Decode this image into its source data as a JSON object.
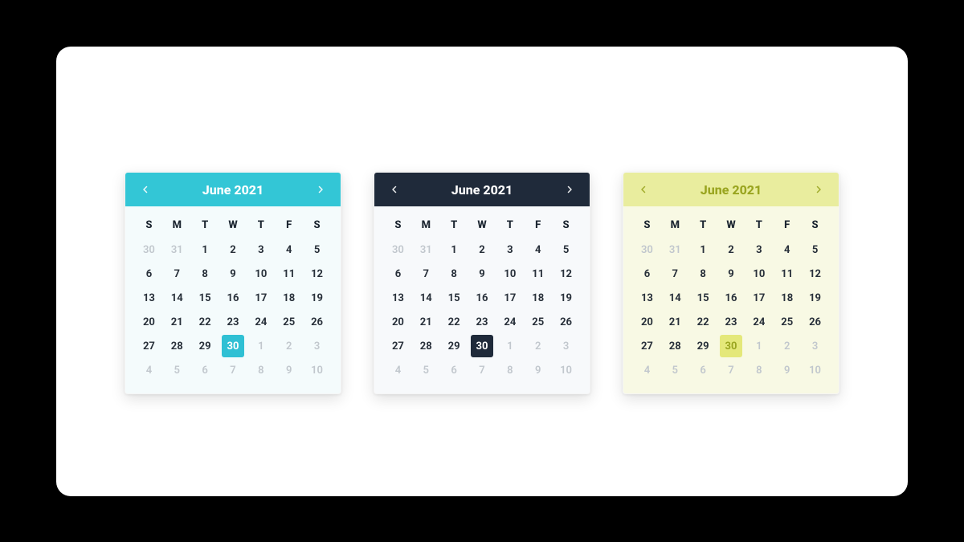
{
  "dow": [
    "S",
    "M",
    "T",
    "W",
    "T",
    "F",
    "S"
  ],
  "grid": {
    "days": [
      30,
      31,
      1,
      2,
      3,
      4,
      5,
      6,
      7,
      8,
      9,
      10,
      11,
      12,
      13,
      14,
      15,
      16,
      17,
      18,
      19,
      20,
      21,
      22,
      23,
      24,
      25,
      26,
      27,
      28,
      29,
      30,
      1,
      2,
      3,
      4,
      5,
      6,
      7,
      8,
      9,
      10
    ],
    "muted": [
      1,
      1,
      0,
      0,
      0,
      0,
      0,
      0,
      0,
      0,
      0,
      0,
      0,
      0,
      0,
      0,
      0,
      0,
      0,
      0,
      0,
      0,
      0,
      0,
      0,
      0,
      0,
      0,
      0,
      0,
      0,
      0,
      1,
      1,
      1,
      1,
      1,
      1,
      1,
      1,
      1,
      1
    ],
    "selectedIndex": 31
  },
  "calendars": [
    {
      "variant": "cyan",
      "title": "June 2021"
    },
    {
      "variant": "dark",
      "title": "June 2021"
    },
    {
      "variant": "lime",
      "title": "June 2021"
    }
  ]
}
